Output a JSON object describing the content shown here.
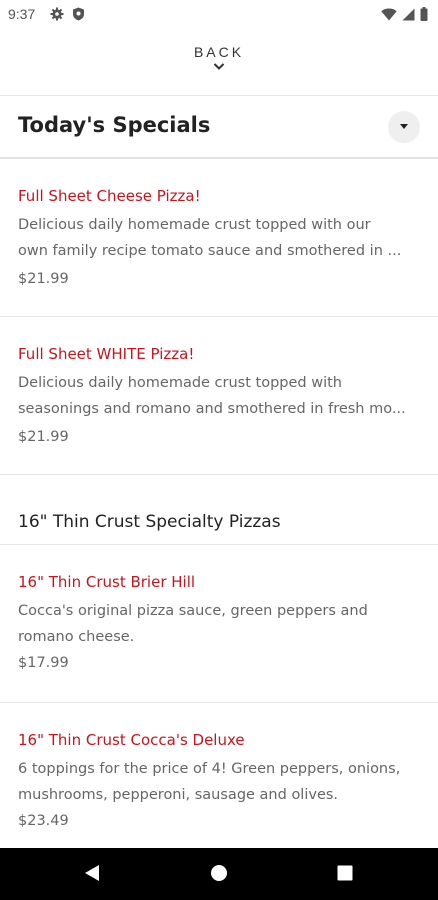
{
  "status_bar": {
    "time": "9:37",
    "left_icons": [
      "gear-icon",
      "shield-icon"
    ],
    "right_icons": [
      "wifi-icon",
      "signal-icon",
      "battery-icon"
    ]
  },
  "nav": {
    "back_label": "BACK"
  },
  "section": {
    "title": "Today's Specials"
  },
  "items": [
    {
      "name": "Full Sheet Cheese Pizza!",
      "description_lines": [
        "Delicious daily homemade crust topped with our",
        "own family recipe tomato sauce and smothered in ..."
      ],
      "price": "$21.99"
    },
    {
      "name": "Full Sheet WHITE Pizza!",
      "description_lines": [
        "Delicious daily homemade crust topped with",
        "seasonings and romano and smothered in fresh mo..."
      ],
      "price": "$21.99"
    },
    {
      "name": "16\" Thin Crust Brier Hill",
      "description_lines": [
        "Cocca's original pizza sauce, green peppers and",
        "romano cheese."
      ],
      "price": "$17.99"
    },
    {
      "name": "16\" Thin Crust Cocca's Deluxe",
      "description_lines": [
        "6 toppings for the price of 4! Green peppers, onions,",
        "mushrooms, pepperoni, sausage and olives."
      ],
      "price": "$23.49"
    }
  ],
  "category": {
    "title": "16\" Thin Crust Specialty Pizzas"
  },
  "colors": {
    "item_name": "#c8141c",
    "text": "#222222",
    "muted": "#666666",
    "divider": "#e6e6e6"
  },
  "system_nav": [
    "back-triangle-icon",
    "home-circle-icon",
    "recents-square-icon"
  ]
}
